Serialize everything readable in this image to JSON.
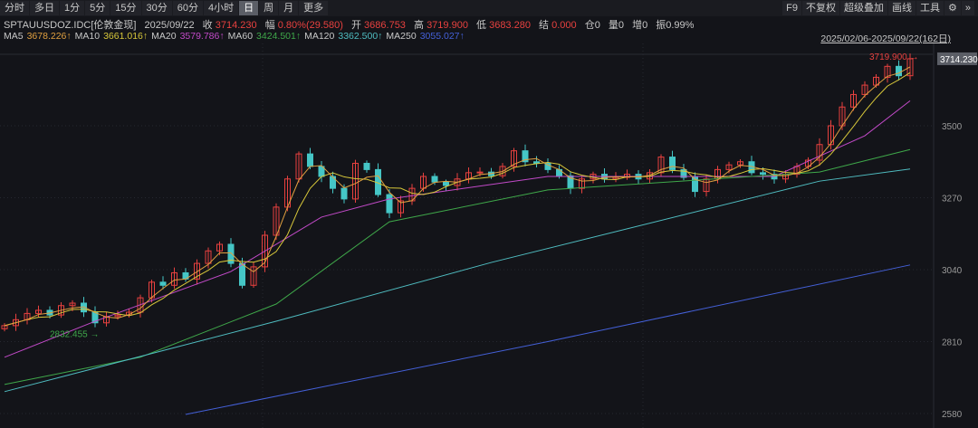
{
  "toolbar": {
    "periods": [
      "分时",
      "多日",
      "1分",
      "5分",
      "15分",
      "30分",
      "60分",
      "4小时",
      "日",
      "周",
      "月",
      "更多"
    ],
    "active": "日",
    "right": [
      "F9",
      "不复权",
      "超级叠加",
      "画线",
      "工具",
      "⚙",
      "»"
    ]
  },
  "quote": {
    "symbol": "SPTAUUSDOZ.IDC[伦敦金现]",
    "date": "2025/09/22",
    "close_label": "收",
    "close": "3714.230",
    "change_label": "幅",
    "change": "0.80%(29.580)",
    "open_label": "开",
    "open": "3686.753",
    "high_label": "高",
    "high": "3719.900",
    "low_label": "低",
    "low": "3683.280",
    "settle_label": "结",
    "settle": "0.000",
    "oi_label": "仓",
    "oi": "0",
    "vol_label": "量",
    "vol": "0",
    "inc_label": "增",
    "inc": "0",
    "amp_label": "振",
    "amp": "0.99%"
  },
  "ma_legend": [
    {
      "name": "MA5",
      "value": "3678.226↑",
      "color": "#e0a040"
    },
    {
      "name": "MA10",
      "value": "3661.016↑",
      "color": "#d8c83a"
    },
    {
      "name": "MA20",
      "value": "3579.786↑",
      "color": "#c24ac8"
    },
    {
      "name": "MA60",
      "value": "3424.501↑",
      "color": "#3fa84a"
    },
    {
      "name": "MA120",
      "value": "3362.500↑",
      "color": "#4fbcc0"
    },
    {
      "name": "MA250",
      "value": "3055.027↑",
      "color": "#4460d8"
    }
  ],
  "range_label": "2025/02/06-2025/09/22(162日)",
  "chart_data": {
    "type": "candlestick",
    "y_ticks": [
      3500,
      3270,
      3040,
      2810,
      2580
    ],
    "ylim": [
      2570,
      3745
    ],
    "grid": true,
    "up_color": "#e8413f",
    "down_color": "#45c6c6",
    "last_price_tag": "3714.230",
    "max_label": "3719.900",
    "min_label": "2832.455",
    "closes": [
      2861,
      2880,
      2900,
      2910,
      2895,
      2925,
      2933,
      2905,
      2870,
      2890,
      2895,
      2904,
      2950,
      3000,
      2990,
      3030,
      3010,
      3060,
      3100,
      3121,
      3060,
      2990,
      3049,
      3150,
      3240,
      3330,
      3410,
      3370,
      3338,
      3300,
      3266,
      3380,
      3360,
      3280,
      3222,
      3260,
      3300,
      3338,
      3320,
      3309,
      3330,
      3350,
      3352,
      3340,
      3370,
      3420,
      3385,
      3380,
      3360,
      3340,
      3300,
      3330,
      3345,
      3330,
      3335,
      3345,
      3330,
      3350,
      3400,
      3360,
      3335,
      3290,
      3330,
      3360,
      3375,
      3385,
      3350,
      3345,
      3330,
      3345,
      3370,
      3390,
      3440,
      3500,
      3560,
      3600,
      3630,
      3655,
      3690,
      3660,
      3714.23
    ],
    "ma_lines": {
      "MA20": [
        [
          0,
          2760
        ],
        [
          8,
          2875
        ],
        [
          20,
          3034
        ],
        [
          28,
          3208
        ],
        [
          34,
          3266
        ],
        [
          48,
          3338
        ],
        [
          68,
          3338
        ],
        [
          76,
          3468
        ],
        [
          80,
          3580
        ]
      ],
      "MA60": [
        [
          0,
          2673
        ],
        [
          12,
          2760
        ],
        [
          24,
          2930
        ],
        [
          34,
          3193
        ],
        [
          48,
          3295
        ],
        [
          72,
          3352
        ],
        [
          80,
          3424
        ]
      ],
      "MA120": [
        [
          0,
          2650
        ],
        [
          24,
          2875
        ],
        [
          43,
          3063
        ],
        [
          72,
          3323
        ],
        [
          80,
          3362
        ]
      ],
      "MA250": [
        [
          16,
          2577
        ],
        [
          48,
          2810
        ],
        [
          80,
          3055
        ]
      ]
    }
  }
}
